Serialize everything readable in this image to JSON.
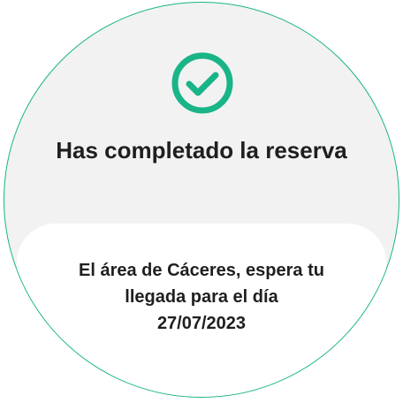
{
  "screen": {
    "status_icon": "check-circle-icon",
    "accent_color": "#19b487",
    "title": "Has completado la reserva",
    "message_line1": "El área de Cáceres, espera tu",
    "message_line2": "llegada para el día",
    "message_date": "27/07/2023"
  }
}
